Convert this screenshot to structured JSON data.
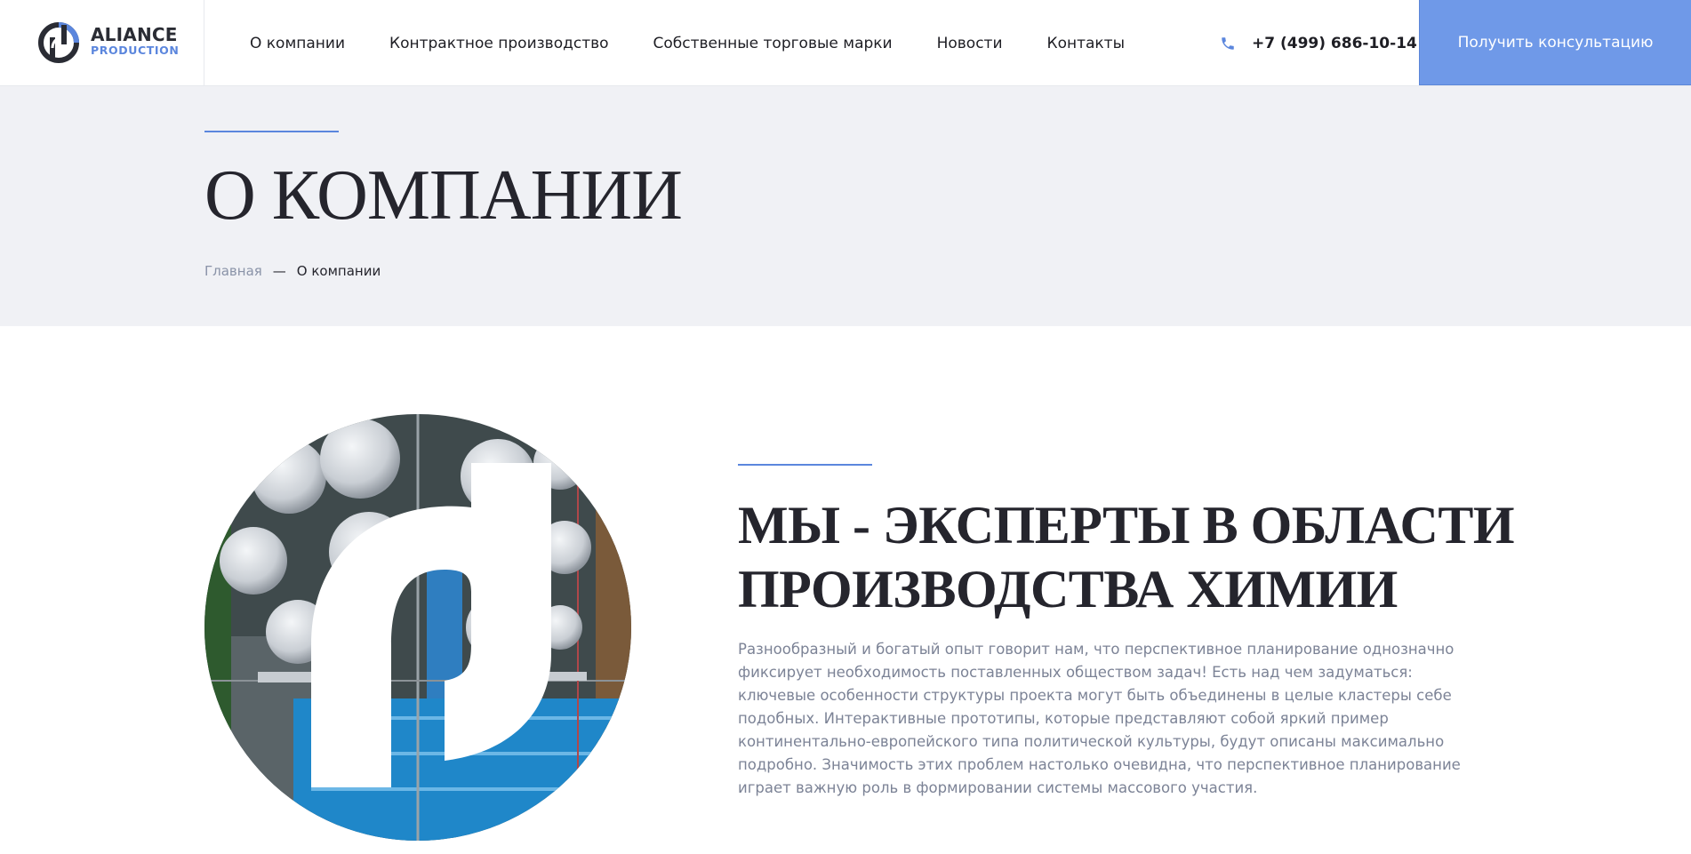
{
  "header": {
    "logo": {
      "line1": "ALIANCE",
      "line2": "PRODUCTION"
    },
    "nav": [
      {
        "label": "О компании"
      },
      {
        "label": "Контрактное производство"
      },
      {
        "label": "Собственные торговые марки"
      },
      {
        "label": "Новости"
      },
      {
        "label": "Контакты"
      }
    ],
    "phone": "+7 (499) 686-10-14",
    "cta_label": "Получить консультацию"
  },
  "page": {
    "title": "О КОМПАНИИ",
    "breadcrumb": {
      "home": "Главная",
      "separator": "—",
      "current": "О компании"
    }
  },
  "about": {
    "title_line1": "МЫ - ЭКСПЕРТЫ В ОБЛАСТИ",
    "title_line2": "ПРОИЗВОДСТВА ХИМИИ",
    "text": "Разнообразный и богатый опыт говорит нам, что перспективное планирование однозначно фиксирует необходимость поставленных обществом задач! Есть над чем задуматься: ключевые особенности структуры проекта могут быть объединены в целые кластеры себе подобных. Интерактивные прототипы, которые представляют собой яркий пример континентально-европейского типа политической культуры, будут описаны максимально подробно. Значимость этих проблем настолько очевидна, что перспективное планирование играет важную роль в формировании системы массового участия."
  },
  "colors": {
    "accent": "#5b86dd",
    "cta_bg": "#6f99e8",
    "band_bg": "#f0f1f5",
    "text_dark": "#25252d",
    "text_muted": "#7c8396"
  },
  "icons": {
    "logo": "logo-mark-icon",
    "phone": "phone-icon"
  }
}
